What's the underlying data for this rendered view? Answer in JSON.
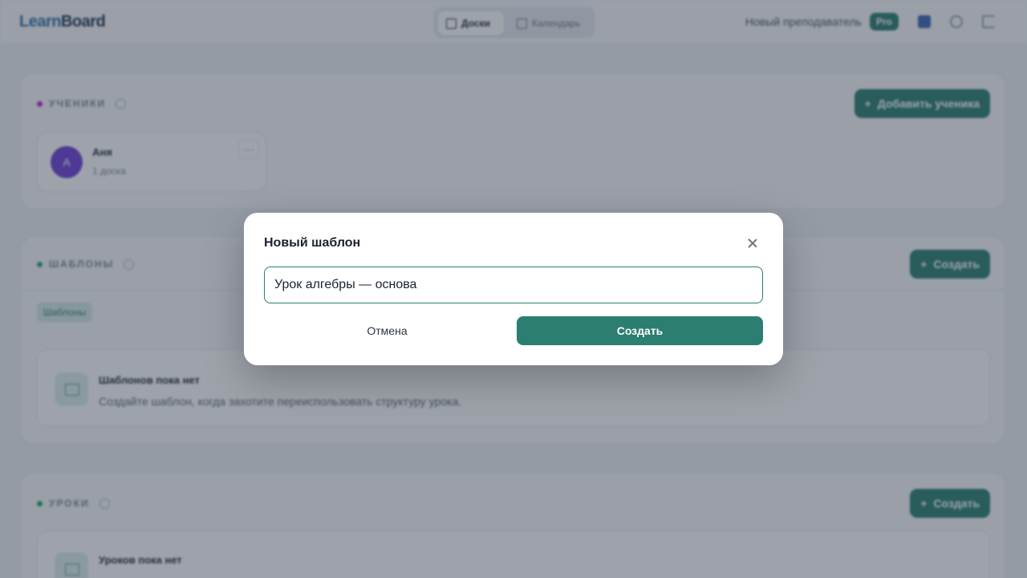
{
  "app": {
    "logo_part1": "Learn",
    "logo_part2": "Board",
    "tabs": [
      {
        "label": "Доски",
        "icon": "grid-icon",
        "active": true
      },
      {
        "label": "Календарь",
        "icon": "calendar-icon",
        "active": false
      }
    ],
    "user_name": "Новый преподаватель",
    "plan_badge": "Pro",
    "accent_color": "#2b7e70"
  },
  "students": {
    "title": "УЧЕНИКИ",
    "dot_color": "#c026d3",
    "add_button": "Добавить ученика",
    "items": [
      {
        "initial": "А",
        "name": "Аня",
        "meta": "1 доска"
      }
    ]
  },
  "templates": {
    "title": "ШАБЛОНЫ",
    "dot_color": "#2b9f8a",
    "create_button": "Создать",
    "filter_chip": "Шаблоны",
    "empty_title": "Шаблонов пока нет",
    "empty_text": "Создайте шаблон, когда захотите переиспользовать структуру урока."
  },
  "lessons": {
    "title": "УРОКИ",
    "dot_color": "#22a861",
    "create_button": "Создать",
    "empty_title": "Уроков пока нет"
  },
  "modal": {
    "title": "Новый шаблон",
    "input_value": "Урок алгебры — основа",
    "cancel_label": "Отмена",
    "create_label": "Создать"
  }
}
